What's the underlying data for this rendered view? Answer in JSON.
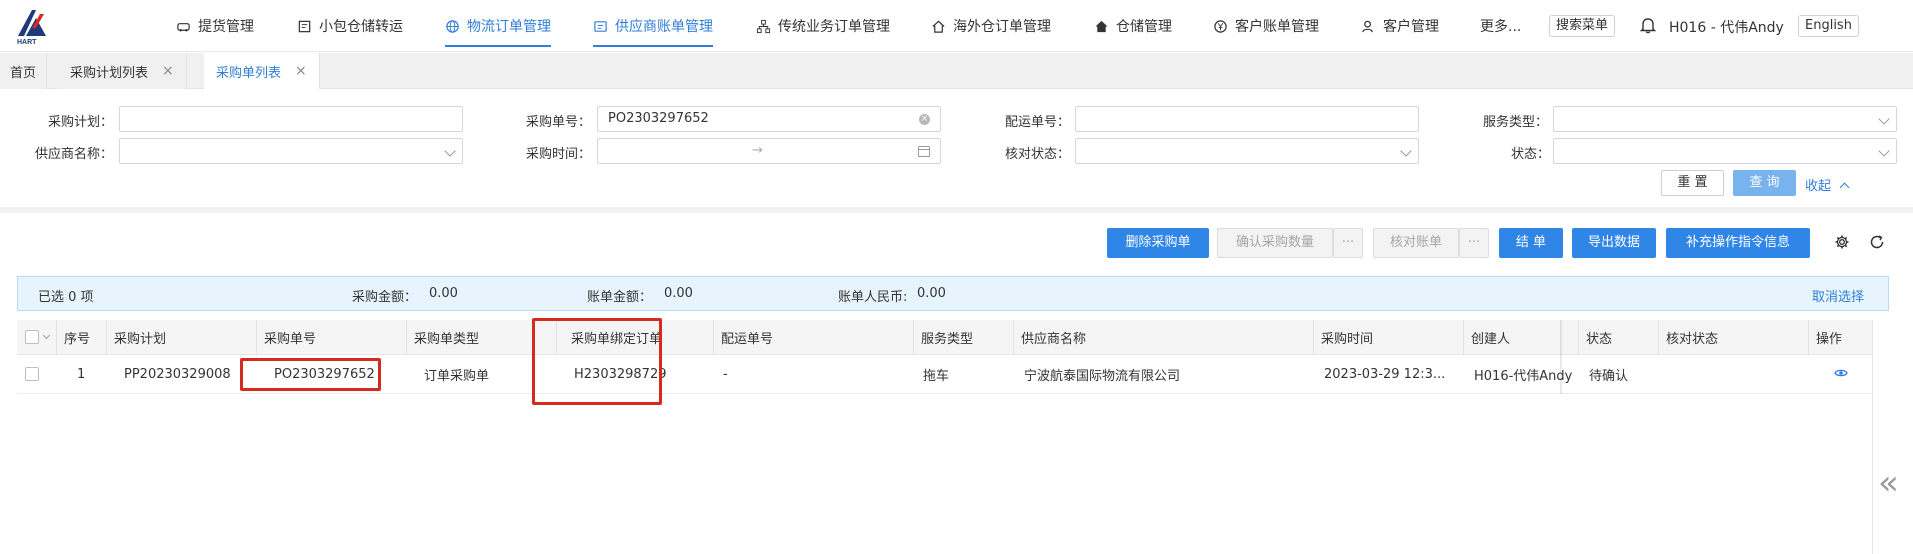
{
  "brand": {
    "logo_text": "HART"
  },
  "navbar": {
    "items": [
      {
        "label": "提货管理",
        "icon": "car-icon"
      },
      {
        "label": "小包仓储转运",
        "icon": "box-icon"
      },
      {
        "label": "物流订单管理",
        "icon": "globe-icon",
        "active": true
      },
      {
        "label": "供应商账单管理",
        "icon": "bill-icon",
        "active": true
      },
      {
        "label": "传统业务订单管理",
        "icon": "org-icon"
      },
      {
        "label": "海外仓订单管理",
        "icon": "home-icon"
      },
      {
        "label": "仓储管理",
        "icon": "house-filled-icon"
      },
      {
        "label": "客户账单管理",
        "icon": "yen-icon"
      },
      {
        "label": "客户管理",
        "icon": "user-icon"
      },
      {
        "label": "更多..."
      }
    ],
    "search_menu": "搜索菜单",
    "user": "H016 - 代伟Andy",
    "language": "English"
  },
  "tabs": [
    {
      "label": "首页"
    },
    {
      "label": "采购计划列表",
      "closable": true
    },
    {
      "label": "采购单列表",
      "closable": true,
      "active": true
    }
  ],
  "filters": {
    "purchase_plan": {
      "label": "采购计划：",
      "value": ""
    },
    "purchase_no": {
      "label": "采购单号：",
      "value": "PO2303297652"
    },
    "delivery_no": {
      "label": "配运单号：",
      "value": ""
    },
    "service_type": {
      "label": "服务类型：",
      "value": ""
    },
    "supplier_name": {
      "label": "供应商名称：",
      "value": ""
    },
    "purchase_time": {
      "label": "采购时间：",
      "range_separator": "→"
    },
    "check_status": {
      "label": "核对状态：",
      "value": ""
    },
    "status": {
      "label": "状态：",
      "value": ""
    },
    "reset": "重 置",
    "query": "查 询",
    "collapse": "收起"
  },
  "toolbar": {
    "delete": "删除采购单",
    "confirm_qty": "确认采购数量",
    "check_bill": "核对账单",
    "more": "···",
    "settle": "结 单",
    "export": "导出数据",
    "supplement": "补充操作指令信息"
  },
  "selection": {
    "selected": "已选 0 项",
    "purchase_amount_label": "采购金额：",
    "purchase_amount": "0.00",
    "bill_amount_label": "账单金额：",
    "bill_amount": "0.00",
    "bill_rmb_label": "账单人民币: ",
    "bill_rmb": "0.00",
    "cancel": "取消选择"
  },
  "table": {
    "columns": [
      "序号",
      "采购计划",
      "采购单号",
      "采购单类型",
      "采购单绑定订单",
      "配运单号",
      "服务类型",
      "供应商名称",
      "采购时间",
      "创建人",
      "状态",
      "核对状态",
      "操作"
    ],
    "rows": [
      {
        "index": "1",
        "plan": "PP20230329008",
        "purchase_no": "PO2303297652",
        "type": "订单采购单",
        "bound_order": "H2303298729",
        "delivery_no": "-",
        "service_type": "拖车",
        "supplier": "宁波航泰国际物流有限公司",
        "time": "2023-03-29 12:3...",
        "creator": "H016-代伟Andy",
        "status": "待确认",
        "check_status": ""
      }
    ]
  },
  "colors": {
    "accent": "#2f86e6",
    "highlight": "#d42b1e",
    "selection_bg": "#e8f4fd"
  }
}
